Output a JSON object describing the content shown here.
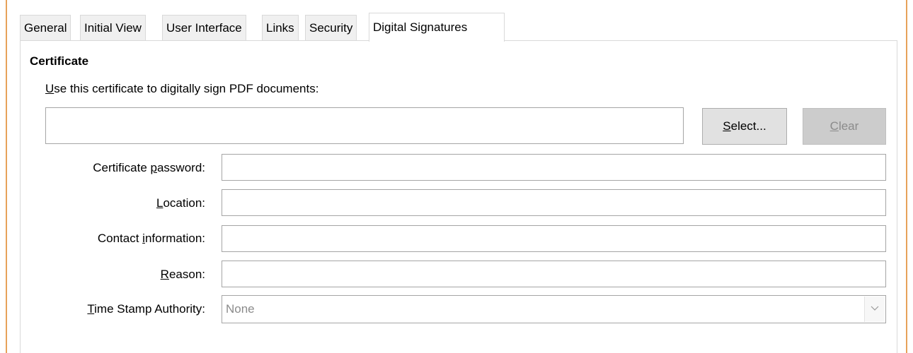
{
  "tabs": [
    {
      "label": "General"
    },
    {
      "label": "Initial View"
    },
    {
      "label": "User Interface"
    },
    {
      "label": "Links"
    },
    {
      "label": "Security"
    },
    {
      "label": "Digital Signatures",
      "active": true
    }
  ],
  "certificate": {
    "section_title": "Certificate",
    "description_prefix_mnemonic": "U",
    "description_rest": "se this certificate to digitally sign PDF documents:",
    "value": "",
    "select_button": {
      "mnemonic": "S",
      "rest": "elect..."
    },
    "clear_button": {
      "mnemonic": "C",
      "rest": "lear"
    }
  },
  "fields": {
    "password": {
      "before": "Certificate ",
      "mnemonic": "p",
      "after": "assword:",
      "value": ""
    },
    "location": {
      "before": "",
      "mnemonic": "L",
      "after": "ocation:",
      "value": ""
    },
    "contact": {
      "before": "Contact ",
      "mnemonic": "i",
      "after": "nformation:",
      "value": ""
    },
    "reason": {
      "before": "",
      "mnemonic": "R",
      "after": "eason:",
      "value": ""
    },
    "tsa": {
      "before": "",
      "mnemonic": "T",
      "after": "ime Stamp Authority:",
      "selected": "None"
    }
  },
  "icons": {
    "dropdown": "chevron-down-icon"
  },
  "colors": {
    "window_edge": "#e7a25a",
    "disabled_text": "#8b8b8b"
  }
}
